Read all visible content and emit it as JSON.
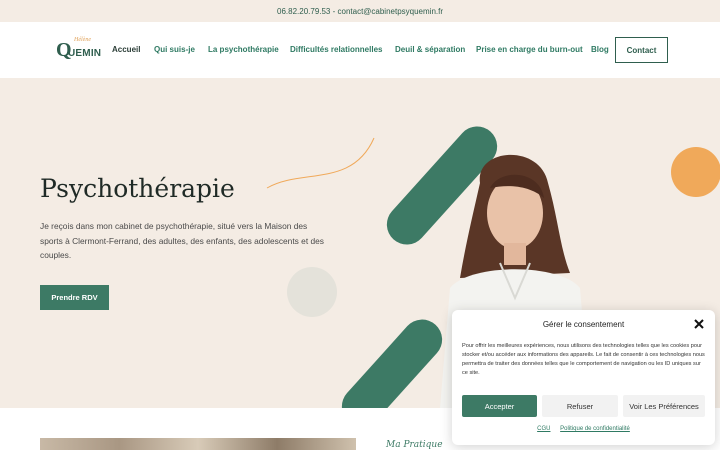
{
  "topbar": {
    "contact_info": "06.82.20.79.53 - contact@cabinetpsyquemin.fr"
  },
  "logo": {
    "first_name": "Hélène",
    "q": "Q",
    "rest": "UEMIN"
  },
  "nav": {
    "items": [
      {
        "label": "Accueil",
        "active": true
      },
      {
        "label": "Qui suis-je"
      },
      {
        "label": "La psychothérapie"
      },
      {
        "label": "Difficultés relationnelles"
      },
      {
        "label": "Deuil & séparation"
      },
      {
        "label": "Prise en charge du burn-out"
      },
      {
        "label": "Blog"
      }
    ],
    "contact_label": "Contact"
  },
  "hero": {
    "title": "Psychothérapie",
    "text": "Je reçois dans mon cabinet de psychothérapie, situé vers la Maison des sports à Clermont-Ferrand, des adultes, des enfants, des adolescents et des couples.",
    "cta_label": "Prendre RDV"
  },
  "section": {
    "subtitle": "Ma Pratique"
  },
  "consent": {
    "title": "Gérer le consentement",
    "text": "Pour offrir les meilleures expériences, nous utilisons des technologies telles que les cookies pour stocker et/ou accéder aux informations des appareils. Le fait de consentir à ces technologies nous permettra de traiter des données telles que le comportement de navigation ou les ID uniques sur ce site.",
    "accept_label": "Accepter",
    "refuse_label": "Refuser",
    "prefs_label": "Voir Les Préférences",
    "link_cgu": "CGU",
    "link_privacy": "Politique de confidentialité"
  },
  "colors": {
    "brand_green": "#3d7a65",
    "accent_orange": "#f0a95a",
    "hero_bg": "#f4ece4"
  },
  "icons": [
    "close-icon"
  ]
}
